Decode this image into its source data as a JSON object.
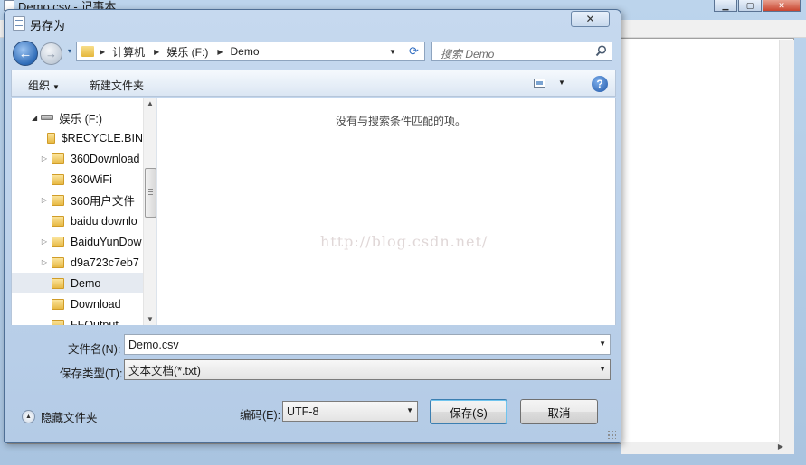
{
  "notepad": {
    "title": "Demo.csv - 记事本"
  },
  "dialog": {
    "title": "另存为",
    "close_glyph": "✕",
    "nav": {
      "back_glyph": "←",
      "forward_glyph": "→",
      "history_glyph": "▾",
      "breadcrumbs": [
        "计算机",
        "娱乐 (F:)",
        "Demo"
      ],
      "refresh_glyph": "⟳"
    },
    "search": {
      "placeholder": "搜索 Demo"
    },
    "toolbar": {
      "organize_label": "组织",
      "organize_arrow": "▼",
      "new_folder_label": "新建文件夹",
      "view_arrow": "▼",
      "help_label": "?"
    },
    "navpane": {
      "drive_label": "娱乐 (F:)",
      "items": [
        {
          "name": "$RECYCLE.BIN",
          "expandable": false,
          "selected": false
        },
        {
          "name": "360Download",
          "expandable": true,
          "selected": false
        },
        {
          "name": "360WiFi",
          "expandable": false,
          "selected": false
        },
        {
          "name": "360用户文件",
          "expandable": true,
          "selected": false
        },
        {
          "name": "baidu downlo",
          "expandable": false,
          "selected": false
        },
        {
          "name": "BaiduYunDow",
          "expandable": true,
          "selected": false
        },
        {
          "name": "d9a723c7eb7",
          "expandable": true,
          "selected": false
        },
        {
          "name": "Demo",
          "expandable": false,
          "selected": true
        },
        {
          "name": "Download",
          "expandable": false,
          "selected": false
        },
        {
          "name": "FFOutput",
          "expandable": false,
          "selected": false
        }
      ]
    },
    "filelist": {
      "empty_message": "没有与搜索条件匹配的项。",
      "watermark": "http://blog.csdn.net/"
    },
    "form": {
      "filename_label": "文件名(N):",
      "filename_value": "Demo.csv",
      "filetype_label": "保存类型(T):",
      "filetype_value": "文本文档(*.txt)",
      "encoding_label": "编码(E):",
      "encoding_value": "UTF-8"
    },
    "hide_folders_label": "隐藏文件夹",
    "buttons": {
      "save": "保存(S)",
      "cancel": "取消"
    }
  },
  "colors": {
    "dialog_frame": "#c6d9ef",
    "default_button_border": "#3c7fb1",
    "selected_row": "#e5eaf1"
  }
}
